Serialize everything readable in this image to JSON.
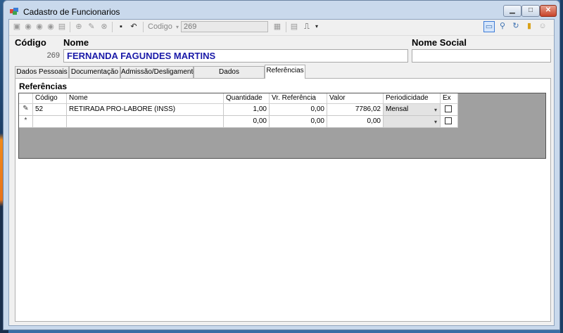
{
  "window": {
    "title": "Cadastro de Funcionarios"
  },
  "toolbar": {
    "label": "Codigo",
    "combo_value": "269"
  },
  "header": {
    "codigo_label": "Código",
    "nome_label": "Nome",
    "nome_social_label": "Nome Social",
    "codigo_value": "269",
    "nome_value": "FERNANDA FAGUNDES MARTINS",
    "nome_social_value": ""
  },
  "tabs": [
    "Dados Pessoais",
    "Documentação",
    "Admissão/Desligamento",
    "Dados Complementares",
    "Referências"
  ],
  "section": {
    "title": "Referências"
  },
  "grid": {
    "columns": [
      "Código",
      "Nome",
      "Quantidade",
      "Vr. Referência",
      "Valor",
      "Periodicidade",
      "Ex"
    ],
    "rows": [
      {
        "marker": "✎",
        "codigo": "52",
        "nome": "RETIRADA PRO-LABORE (INSS)",
        "quantidade": "1,00",
        "vr_referencia": "0,00",
        "valor": "7786,02",
        "periodicidade": "Mensal",
        "ex": false
      },
      {
        "marker": "*",
        "codigo": "",
        "nome": "",
        "quantidade": "0,00",
        "vr_referencia": "0,00",
        "valor": "0,00",
        "periodicidade": "",
        "ex": false
      }
    ]
  }
}
